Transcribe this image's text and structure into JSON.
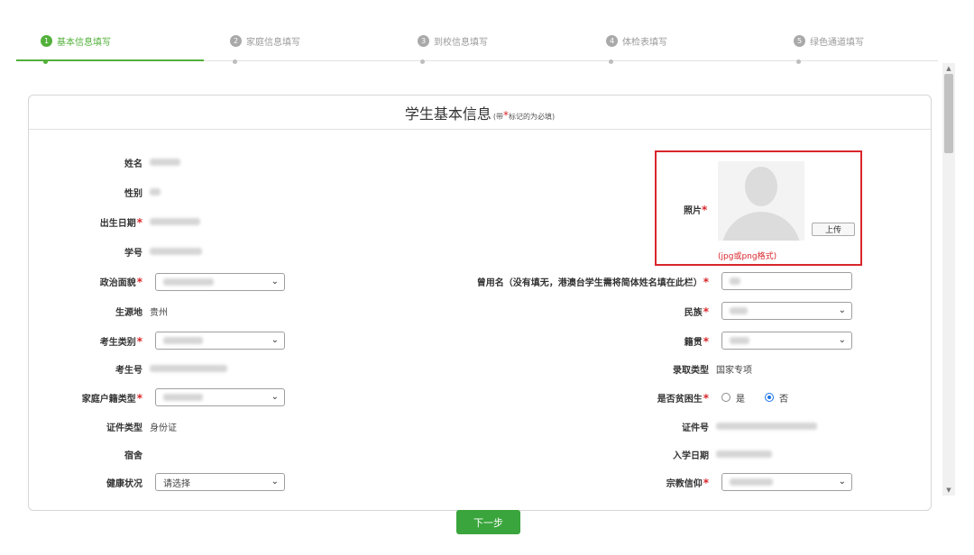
{
  "steps": [
    {
      "num": "1",
      "label": "基本信息填写",
      "active": true
    },
    {
      "num": "2",
      "label": "家庭信息填写",
      "active": false
    },
    {
      "num": "3",
      "label": "到校信息填写",
      "active": false
    },
    {
      "num": "4",
      "label": "体检表填写",
      "active": false
    },
    {
      "num": "5",
      "label": "绿色通道填写",
      "active": false
    }
  ],
  "panel": {
    "title": "学生基本信息",
    "note_prefix": "(带",
    "note_star": "*",
    "note_suffix": "标记的为必填)"
  },
  "left_fields": {
    "name": {
      "label": "姓名"
    },
    "gender": {
      "label": "性别"
    },
    "birth": {
      "label": "出生日期",
      "required": "*"
    },
    "student_no": {
      "label": "学号"
    },
    "politics": {
      "label": "政治面貌",
      "required": "*"
    },
    "origin": {
      "label": "生源地",
      "value": "贵州"
    },
    "exam_type": {
      "label": "考生类别",
      "required": "*"
    },
    "exam_no": {
      "label": "考生号"
    },
    "household": {
      "label": "家庭户籍类型",
      "required": "*"
    },
    "id_type": {
      "label": "证件类型",
      "value": "身份证"
    },
    "dorm": {
      "label": "宿舍"
    },
    "health": {
      "label": "健康状况",
      "value": "请选择"
    }
  },
  "right_fields": {
    "alias": {
      "label": "曾用名（没有填无，港澳台学生需将简体姓名填在此栏）",
      "required": "*"
    },
    "nation": {
      "label": "民族",
      "required": "*"
    },
    "native": {
      "label": "籍贯",
      "required": "*"
    },
    "admit_type": {
      "label": "录取类型",
      "value": "国家专项"
    },
    "poor": {
      "label": "是否贫困生",
      "required": "*",
      "opt_yes": "是",
      "opt_no": "否",
      "selected": "否"
    },
    "id_no": {
      "label": "证件号"
    },
    "enroll_date": {
      "label": "入学日期"
    },
    "religion": {
      "label": "宗教信仰",
      "required": "*"
    }
  },
  "photo": {
    "label": "照片",
    "required": "*",
    "upload": "上传",
    "hint": "(jpg或png格式)"
  },
  "next_button": "下一步",
  "colors": {
    "accent": "#52b03a",
    "required": "#d8262b",
    "radio": "#1a73e8"
  }
}
